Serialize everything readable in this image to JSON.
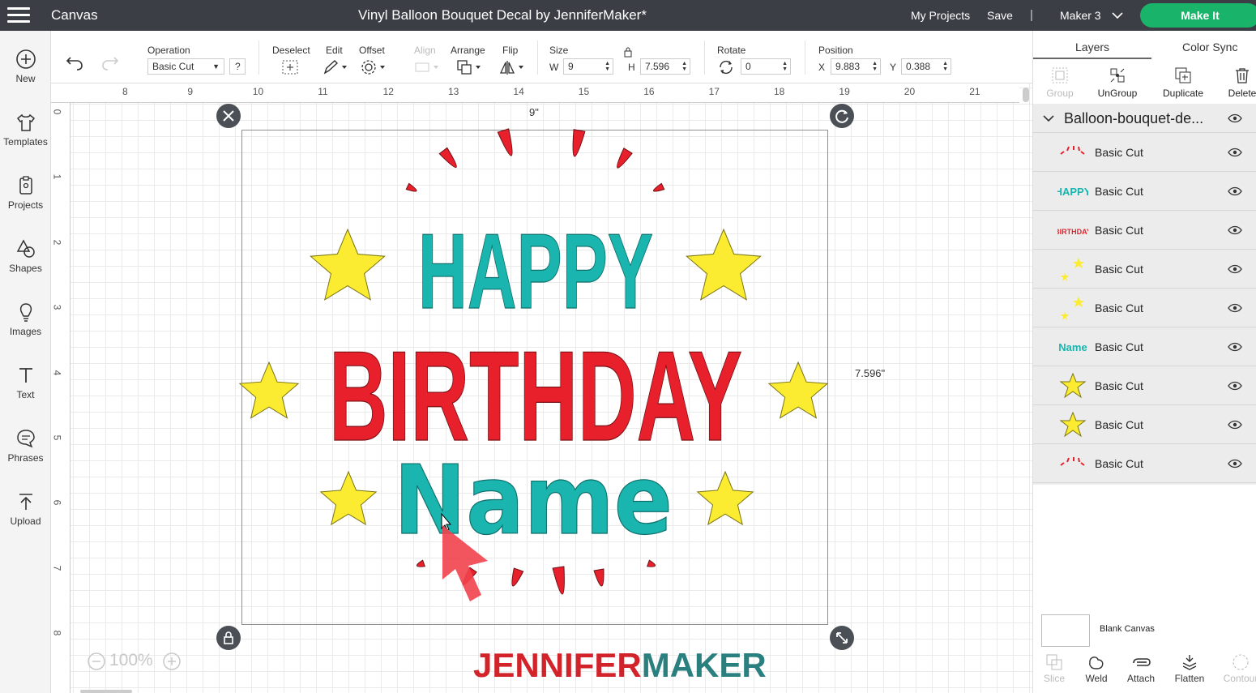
{
  "topbar": {
    "app_title": "Canvas",
    "document_title": "Vinyl Balloon Bouquet Decal by JenniferMaker*",
    "my_projects": "My Projects",
    "save": "Save",
    "separator": "|",
    "machine": "Maker 3",
    "make_it": "Make It"
  },
  "leftnav": [
    {
      "label": "New",
      "icon": "plus-circle-icon"
    },
    {
      "label": "Templates",
      "icon": "shirt-icon"
    },
    {
      "label": "Projects",
      "icon": "clipboard-icon"
    },
    {
      "label": "Shapes",
      "icon": "shapes-icon"
    },
    {
      "label": "Images",
      "icon": "lightbulb-icon"
    },
    {
      "label": "Text",
      "icon": "text-icon"
    },
    {
      "label": "Phrases",
      "icon": "speech-bubble-icon"
    },
    {
      "label": "Upload",
      "icon": "upload-icon"
    }
  ],
  "toolbar": {
    "operation_label": "Operation",
    "operation_value": "Basic Cut",
    "help": "?",
    "deselect": "Deselect",
    "edit": "Edit",
    "offset": "Offset",
    "align": "Align",
    "arrange": "Arrange",
    "flip": "Flip",
    "size_label": "Size",
    "w_label": "W",
    "w_value": "9",
    "h_label": "H",
    "h_value": "7.596",
    "rotate_label": "Rotate",
    "rotate_value": "0",
    "position_label": "Position",
    "x_label": "X",
    "x_value": "9.883",
    "y_label": "Y",
    "y_value": "0.388"
  },
  "rulers": {
    "h_ticks": [
      "8",
      "9",
      "10",
      "11",
      "12",
      "13",
      "14",
      "15",
      "16",
      "17",
      "18",
      "19",
      "20",
      "21"
    ],
    "v_ticks": [
      "0",
      "1",
      "2",
      "3",
      "4",
      "5",
      "6",
      "7",
      "8"
    ]
  },
  "canvas": {
    "width_label": "9\"",
    "height_label": "7.596\"",
    "zoom": "100%",
    "zoom_out": "−",
    "zoom_in": "+"
  },
  "artwork": {
    "line1": "HAPPY",
    "line2": "BIRTHDAY",
    "line3": "Name",
    "colors": {
      "teal": "#19b5ae",
      "red": "#e8202c",
      "yellow": "#fbec32"
    }
  },
  "watermark": {
    "part1": "JENNIFER",
    "part2": "MAKER"
  },
  "panel": {
    "tabs": [
      "Layers",
      "Color Sync"
    ],
    "tools": [
      {
        "label": "Group",
        "enabled": false
      },
      {
        "label": "UnGroup",
        "enabled": true
      },
      {
        "label": "Duplicate",
        "enabled": true
      },
      {
        "label": "Delete",
        "enabled": true
      }
    ],
    "group_name": "Balloon-bouquet-de...",
    "layers": [
      {
        "name": "Basic Cut",
        "thumb": "red-rays"
      },
      {
        "name": "Basic Cut",
        "thumb": "HAPPY"
      },
      {
        "name": "Basic Cut",
        "thumb": "BIRTHDAY"
      },
      {
        "name": "Basic Cut",
        "thumb": "stars-small"
      },
      {
        "name": "Basic Cut",
        "thumb": "stars-small"
      },
      {
        "name": "Basic Cut",
        "thumb": "Name"
      },
      {
        "name": "Basic Cut",
        "thumb": "star"
      },
      {
        "name": "Basic Cut",
        "thumb": "star"
      },
      {
        "name": "Basic Cut",
        "thumb": "red-rays"
      }
    ],
    "blank_canvas": "Blank Canvas",
    "bottom_tools": [
      {
        "label": "Slice",
        "enabled": false
      },
      {
        "label": "Weld",
        "enabled": true
      },
      {
        "label": "Attach",
        "enabled": true
      },
      {
        "label": "Flatten",
        "enabled": true
      },
      {
        "label": "Contour",
        "enabled": false
      }
    ]
  }
}
